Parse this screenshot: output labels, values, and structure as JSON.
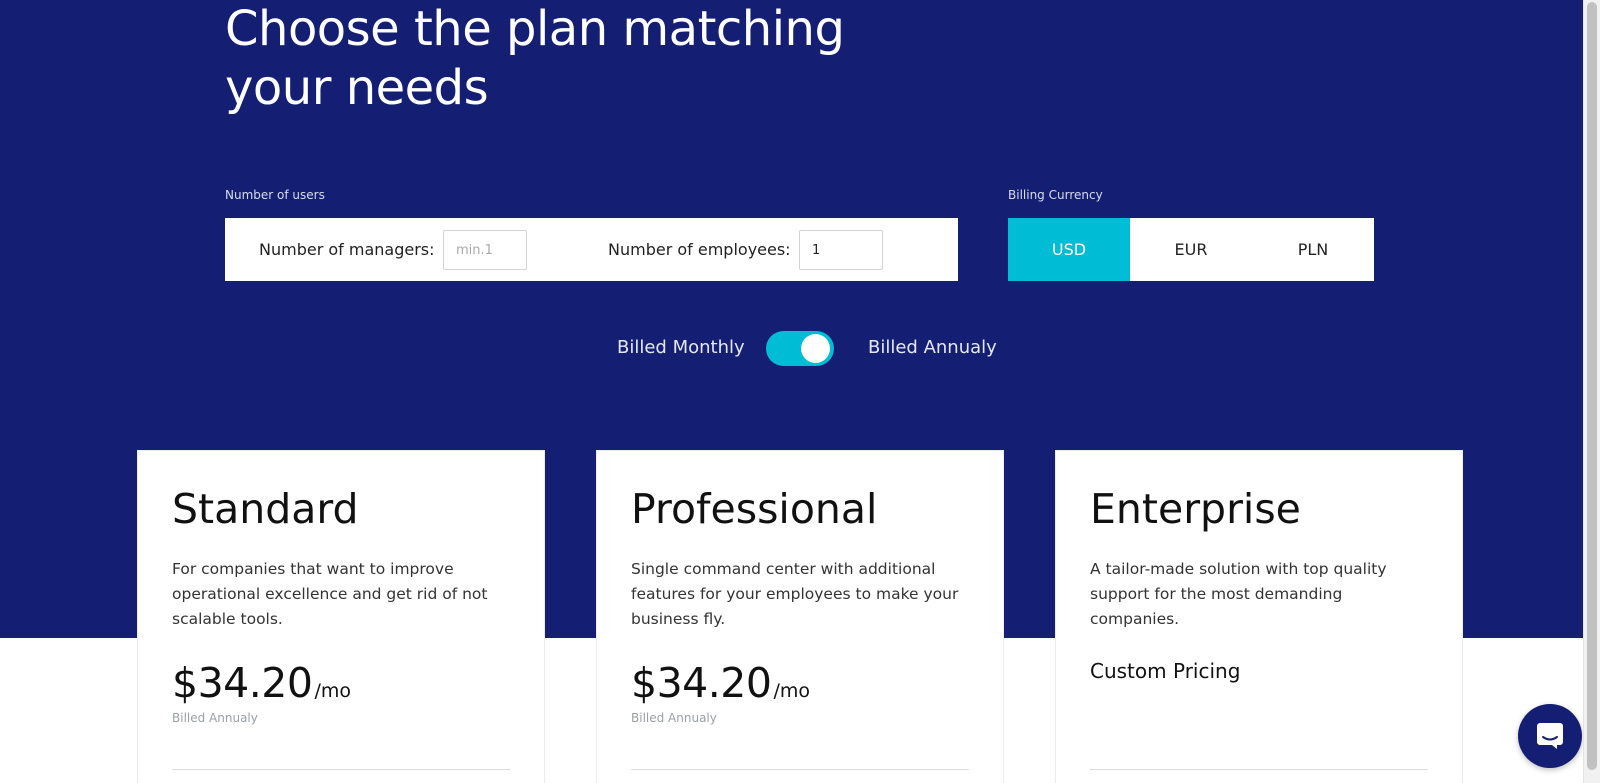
{
  "hero": {
    "title_line1": "Choose the plan matching",
    "title_line2": "your needs"
  },
  "users": {
    "section_label": "Number of users",
    "managers_label": "Number of managers:",
    "managers_placeholder": "min.1",
    "employees_label": "Number of employees:",
    "employees_value": "1"
  },
  "currency": {
    "section_label": "Billing Currency",
    "options": [
      "USD",
      "EUR",
      "PLN"
    ],
    "selected": "USD"
  },
  "billing": {
    "monthly_label": "Billed Monthly",
    "annual_label": "Billed Annualy",
    "annual_selected": true
  },
  "plans": [
    {
      "name": "Standard",
      "description": "For companies that want to improve operational excellence and get rid of not scalable tools.",
      "price": "$34.20",
      "unit": "/mo",
      "note": "Billed Annualy"
    },
    {
      "name": "Professional",
      "description": "Single command center with additional features for your employees to make your business fly.",
      "price": "$34.20",
      "unit": "/mo",
      "note": "Billed Annualy"
    },
    {
      "name": "Enterprise",
      "description": "A tailor-made solution with top quality support for the most demanding companies.",
      "custom_price": "Custom Pricing"
    }
  ],
  "colors": {
    "hero_bg": "#141e73",
    "accent": "#00bcd4",
    "card_bg": "#ffffff"
  },
  "icons": {
    "chat": "chat-bubble-icon"
  }
}
